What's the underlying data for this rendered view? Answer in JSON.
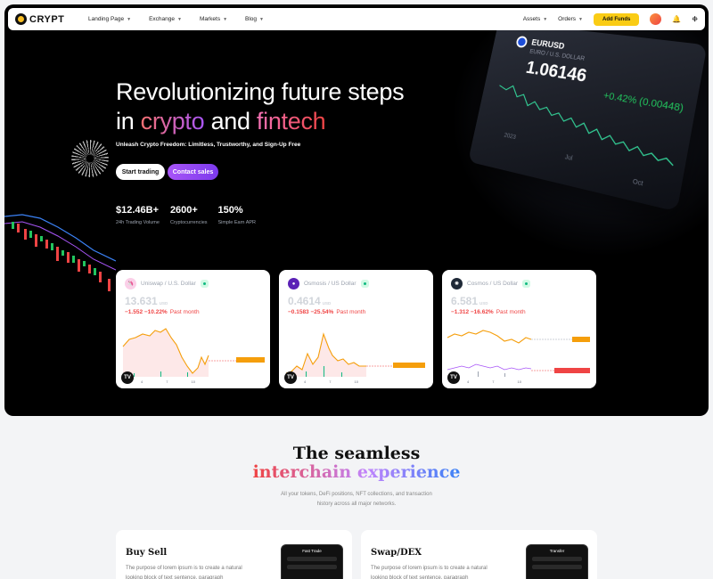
{
  "nav": {
    "brand": "CRYPT",
    "links": [
      "Landing Page",
      "Exchange",
      "Markets",
      "Blog"
    ],
    "assets": "Assets",
    "orders": "Orders",
    "add_funds": "Add Funds"
  },
  "hero": {
    "headline_1": "Revolutionizing future steps",
    "in": "in",
    "crypto": "crypto",
    "and": "and",
    "fintech": "fintech",
    "subline": "Unleash Crypto Freedom: Limitless, Trustworthy, and Sign-Up Free",
    "btn_trade": "Start trading",
    "btn_sales": "Contact sales",
    "stats": [
      {
        "value": "$12.46B+",
        "label": "24h Trading Volume"
      },
      {
        "value": "2600+",
        "label": "Cryptocurrencies"
      },
      {
        "value": "150%",
        "label": "Simple Earn APR"
      }
    ],
    "card": {
      "pair": "EURUSD",
      "subtitle": "EURO / U.S. DOLLAR",
      "price": "1.06146",
      "change": "+0.42% (0.00448)",
      "months": [
        "2023",
        "Jul",
        "Oct"
      ]
    }
  },
  "price_cards": [
    {
      "name": "Uniswap / U.S. Dollar",
      "price": "13.631",
      "unit": "USD",
      "change": "−1.552  −10.22%",
      "period": "Past month",
      "icon_color": "#f472b6",
      "ticks": [
        "4",
        "7",
        "10"
      ]
    },
    {
      "name": "Osmosis / US Dollar",
      "price": "0.4614",
      "unit": "USD",
      "change": "−0.1583  −25.54%",
      "period": "Past month",
      "icon_color": "#7c3aed",
      "ticks": [
        "4",
        "7",
        "10"
      ]
    },
    {
      "name": "Cosmos / US Dollar",
      "price": "6.581",
      "unit": "USD",
      "change": "−1.312  −16.62%",
      "period": "Past month",
      "icon_color": "#1f2937",
      "ticks": [
        "4",
        "7",
        "10"
      ]
    }
  ],
  "section": {
    "title_1": "The seamless",
    "title_2": "interchain experience",
    "sub_1": "All your tokens, DeFi positions, NFT collections, and transaction",
    "sub_2": "history across all major networks."
  },
  "features": [
    {
      "title": "Buy Sell",
      "desc": "The purpose of lorem ipsum is to create a natural looking block of text sentence, paragraph",
      "phone_title": "Fast Trade"
    },
    {
      "title": "Swap/DEX",
      "desc": "The purpose of lorem ipsum is to create a natural looking block of text sentence, paragraph",
      "phone_title": "Transfer"
    }
  ]
}
